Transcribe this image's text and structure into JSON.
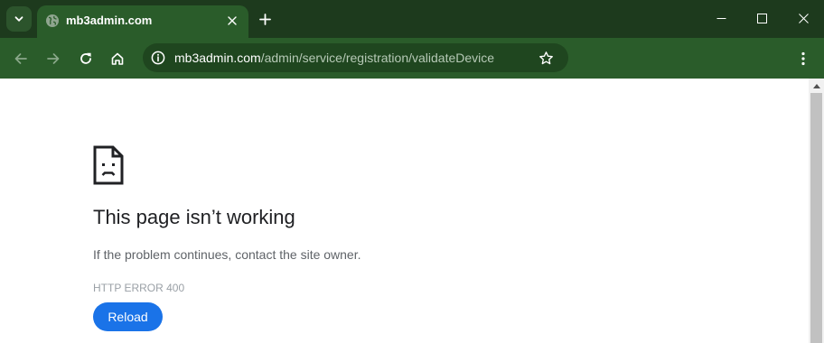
{
  "browser": {
    "tab": {
      "title": "mb3admin.com"
    },
    "address_bar": {
      "host": "mb3admin.com",
      "path": "/admin/service/registration/validateDevice"
    },
    "colors": {
      "frame": "#1d3a1d",
      "toolbar": "#2a5c2a",
      "omnibox": "#1f461f"
    }
  },
  "icons": {
    "tab_search": "chevron-down-icon",
    "favicon": "globe-icon",
    "tab_close": "close-icon",
    "new_tab": "plus-icon",
    "minimize": "minimize-icon",
    "maximize": "maximize-icon",
    "close_window": "close-icon",
    "back": "arrow-left-icon",
    "forward": "arrow-right-icon",
    "reload": "reload-icon",
    "home": "home-icon",
    "site_info": "info-icon",
    "bookmark": "star-icon",
    "menu": "kebab-menu-icon",
    "error": "sad-page-icon"
  },
  "error_page": {
    "title": "This page isn’t working",
    "description": "If the problem continues, contact the site owner.",
    "error_code": "HTTP ERROR 400",
    "reload_label": "Reload",
    "accent_color": "#1a73e8"
  }
}
